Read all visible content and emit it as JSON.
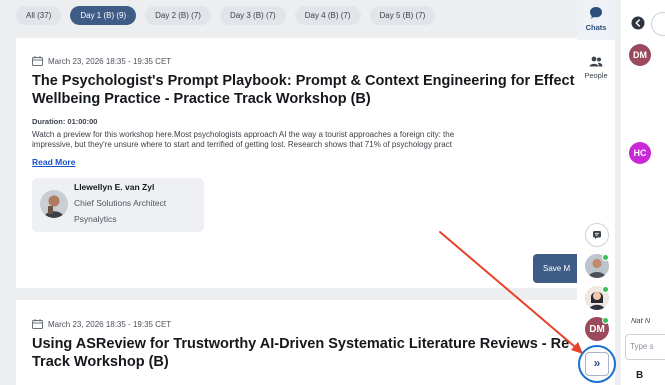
{
  "filters": [
    {
      "label": "All (37)",
      "active": false
    },
    {
      "label": "Day 1 (B) (9)",
      "active": true
    },
    {
      "label": "Day 2 (B) (7)",
      "active": false
    },
    {
      "label": "Day 3 (B) (7)",
      "active": false
    },
    {
      "label": "Day 4 (B) (7)",
      "active": false
    },
    {
      "label": "Day 5 (B) (7)",
      "active": false
    }
  ],
  "sessions": [
    {
      "datetime": "March 23, 2026 18:35 - 19:35 CET",
      "title_line1": "The Psychologist's Prompt Playbook: Prompt & Context Engineering for Effect",
      "title_line2": "Wellbeing Practice - Practice Track Workshop (B)",
      "duration": "Duration: 01:00:00",
      "description_line1": "Watch a preview for this workshop here.Most psychologists approach AI the way a tourist approaches a foreign city: the",
      "description_line2": "impressive, but they're unsure where to start and terrified of getting lost. Research shows that 71% of psychology pract",
      "read_more": "Read More",
      "speaker": {
        "name": "Llewellyn E. van Zyl",
        "role": "Chief Solutions Architect",
        "org": "Psynalytics"
      },
      "save_label": "Save M"
    },
    {
      "datetime": "March 23, 2026 18:35 - 19:35 CET",
      "title_line1": "Using ASReview for Trustworthy AI-Driven Systematic Literature Reviews - Re",
      "title_line2": "Track Workshop (B)"
    }
  ],
  "rail": {
    "chats_label": "Chats",
    "people_label": "People",
    "avatar_initials": "DM",
    "expand_label": "»"
  },
  "chat_panel": {
    "avatars": [
      "DM",
      "HC"
    ],
    "sender_label": "Nat N",
    "input_placeholder": "Type s",
    "bold_label": "B"
  },
  "colors": {
    "accent": "#3f5c86",
    "link": "#1c52c9",
    "online": "#3bbf5a",
    "annotation_arrow": "#e8402b",
    "highlight_ring": "#1b6fd1"
  }
}
